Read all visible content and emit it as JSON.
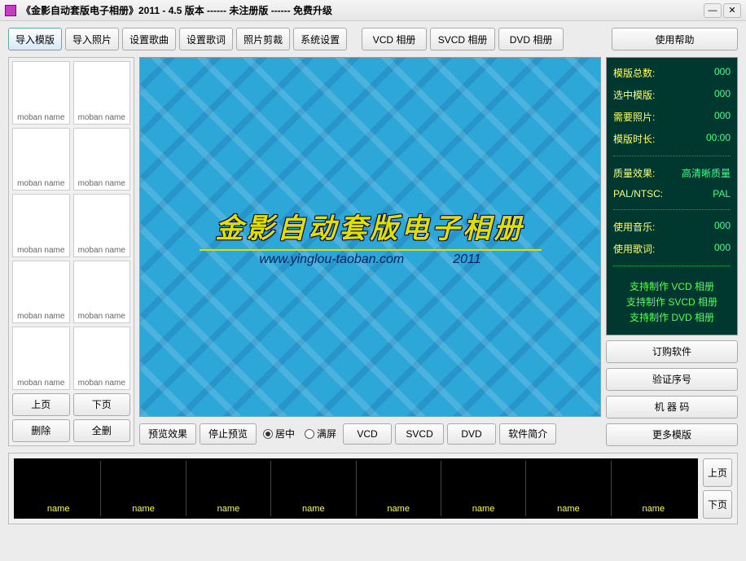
{
  "title": "《金影自动套版电子相册》2011 - 4.5  版本          ------  未注册版  ------  免费升级",
  "toolbar": {
    "import_template": "导入模版",
    "import_photo": "导入照片",
    "set_music": "设置歌曲",
    "set_lyrics": "设置歌词",
    "crop_photo": "照片剪裁",
    "system_settings": "系统设置",
    "vcd_album": "VCD 相册",
    "svcd_album": "SVCD 相册",
    "dvd_album": "DVD 相册",
    "help": "使用帮助"
  },
  "thumbs": [
    "moban  name",
    "moban  name",
    "moban  name",
    "moban  name",
    "moban  name",
    "moban  name",
    "moban  name",
    "moban  name",
    "moban  name",
    "moban  name"
  ],
  "left_buttons": {
    "prev": "上页",
    "next": "下页",
    "delete": "删除",
    "delete_all": "全删"
  },
  "preview": {
    "logo": "金影自动套版电子相册",
    "url": "www.yinglou-taoban.com",
    "year": "2011",
    "preview_effect": "预览效果",
    "stop_preview": "停止预览",
    "center": "居中",
    "fullscreen": "满屏",
    "vcd": "VCD",
    "svcd": "SVCD",
    "dvd": "DVD",
    "about": "软件简介"
  },
  "info": {
    "total_templates_lbl": "模版总数:",
    "total_templates_val": "000",
    "selected_lbl": "选中模版:",
    "selected_val": "000",
    "need_photos_lbl": "需要照片:",
    "need_photos_val": "000",
    "duration_lbl": "模版时长:",
    "duration_val": "00:00",
    "quality_lbl": "质量效果:",
    "quality_val": "高清晰质量",
    "palntsc_lbl": "PAL/NTSC:",
    "palntsc_val": "PAL",
    "music_lbl": "使用音乐:",
    "music_val": "000",
    "lyrics_lbl": "使用歌词:",
    "lyrics_val": "000",
    "support1": "支持制作 VCD 相册",
    "support2": "支持制作 SVCD 相册",
    "support3": "支持制作 DVD 相册"
  },
  "right_buttons": {
    "buy": "订购软件",
    "verify": "验证序号",
    "machine": "机 器 码",
    "more": "更多模版"
  },
  "filmstrip": {
    "cells": [
      "name",
      "name",
      "name",
      "name",
      "name",
      "name",
      "name",
      "name"
    ],
    "prev": "上页",
    "next": "下页"
  }
}
